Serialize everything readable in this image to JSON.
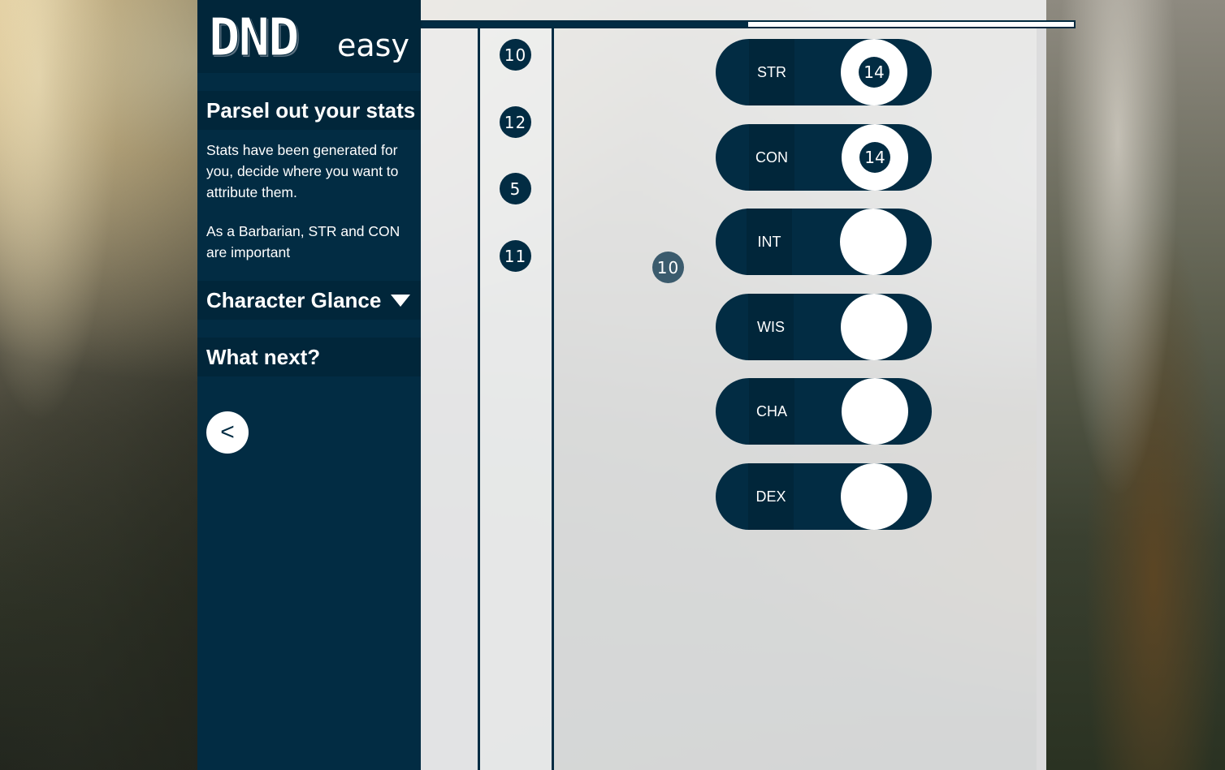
{
  "app": {
    "logo_main": "DND",
    "logo_sub": "easy"
  },
  "sidebar": {
    "step_title": "Parsel out your stats",
    "description": [
      "Stats have been generated for you, decide where you want to attribute them.",
      "As a Barbarian, STR and CON are important"
    ],
    "character_glance": "Character Glance",
    "what_next": "What next?",
    "back_label": "<"
  },
  "progress": {
    "value": 0.5
  },
  "pool": {
    "values": [
      "10",
      "12",
      "5",
      "11"
    ],
    "dragging_value": "10"
  },
  "stats": [
    {
      "label": "STR",
      "value": "14"
    },
    {
      "label": "CON",
      "value": "14"
    },
    {
      "label": "INT",
      "value": ""
    },
    {
      "label": "WIS",
      "value": ""
    },
    {
      "label": "CHA",
      "value": ""
    },
    {
      "label": "DEX",
      "value": ""
    }
  ],
  "colors": {
    "primary": "#022c43",
    "primary_dark": "#01263a",
    "overlay": "#eeeff0",
    "slot": "#ffffff"
  }
}
